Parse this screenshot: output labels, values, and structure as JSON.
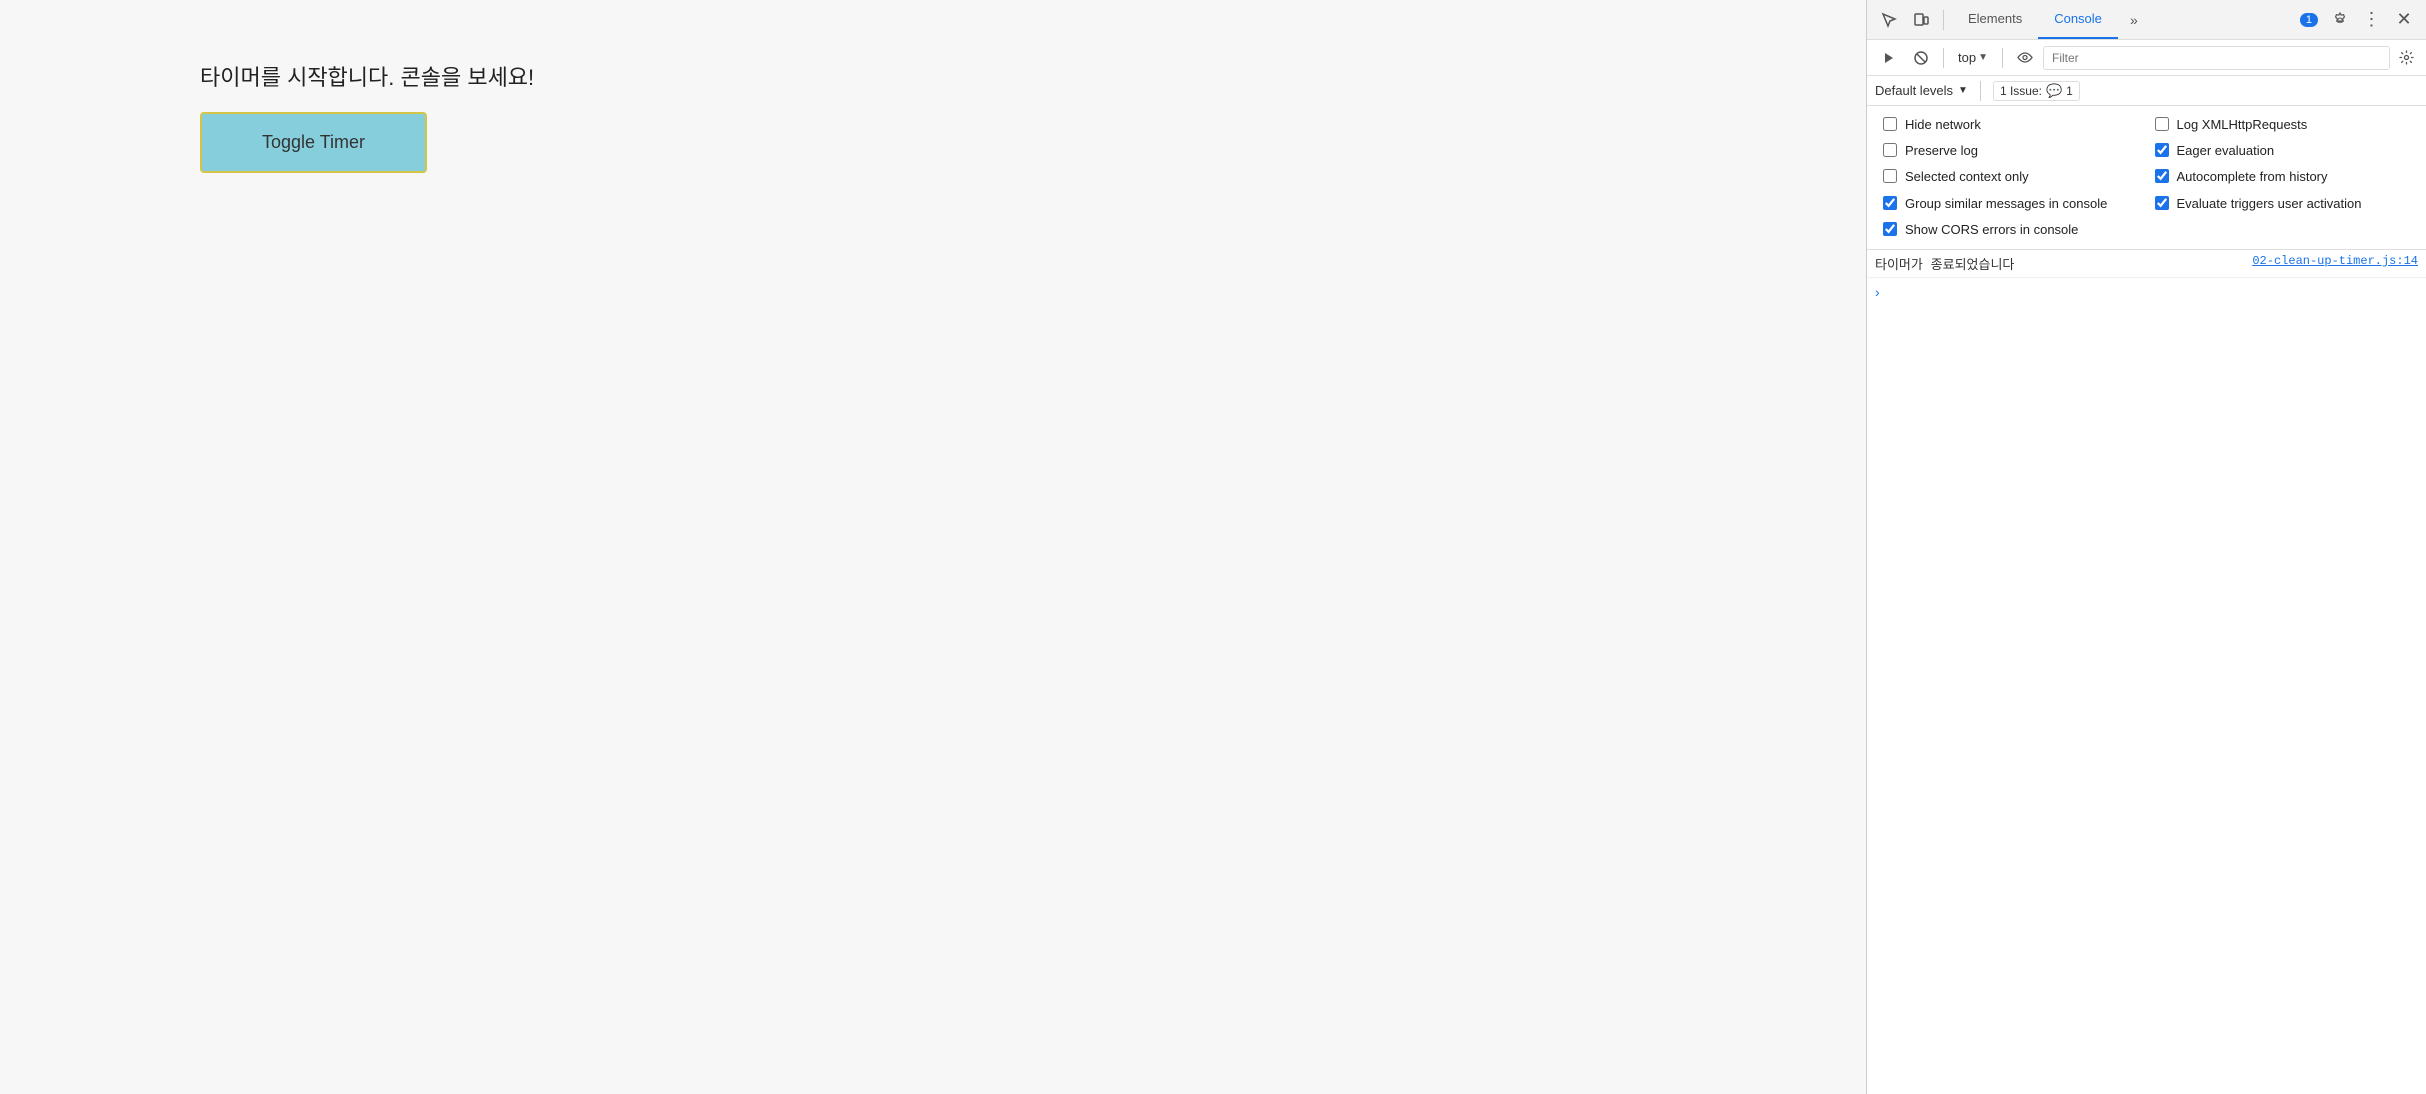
{
  "main": {
    "page_text": "타이머를 시작합니다. 콘솔을 보세요!",
    "toggle_button_label": "Toggle Timer"
  },
  "devtools": {
    "tabs": [
      {
        "label": "Elements",
        "active": false
      },
      {
        "label": "Console",
        "active": true
      }
    ],
    "more_tabs_label": "»",
    "badge_count": "1",
    "toolbar2": {
      "run_icon": "▶",
      "no_icon": "🚫",
      "top_label": "top",
      "eye_icon": "👁",
      "filter_placeholder": "Filter",
      "settings_icon": "⚙"
    },
    "toolbar3": {
      "default_levels_label": "Default levels",
      "issues_label": "1 Issue:",
      "issues_count": "1"
    },
    "settings": {
      "hide_network_label": "Hide network",
      "hide_network_checked": false,
      "log_xmlhttp_label": "Log XMLHttpRequests",
      "log_xmlhttp_checked": false,
      "preserve_log_label": "Preserve log",
      "preserve_log_checked": false,
      "eager_eval_label": "Eager evaluation",
      "eager_eval_checked": true,
      "selected_context_label": "Selected context only",
      "selected_context_checked": false,
      "autocomplete_label": "Autocomplete from history",
      "autocomplete_checked": true,
      "group_similar_label": "Group similar messages in console",
      "group_similar_checked": true,
      "evaluate_triggers_label": "Evaluate triggers user activation",
      "evaluate_triggers_checked": true,
      "show_cors_label": "Show CORS errors in console",
      "show_cors_checked": true
    },
    "console_entries": [
      {
        "text": "타이머가 종료되었습니다",
        "source": "02-clean-up-timer.js:14"
      }
    ],
    "console_prompt": ">"
  }
}
